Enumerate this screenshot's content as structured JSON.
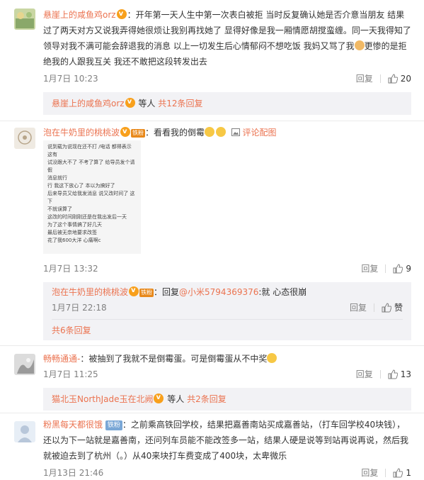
{
  "comments": [
    {
      "username": "悬崖上的咸鱼鸡orz",
      "text": "：开年第一天人生中第一次表白被拒 当时反复确认她是否介意当朋友 结果过了两天对方又说我弄得她很烦让我别再找她了 显得好像是我一厢情愿胡搅蛮缠。同一天我得知了领导对我不满可能会辞退我的消息 以上一切发生后心情郁闷不想吃饭 我妈又骂了我",
      "text_after": "更惨的是拒绝我的人跟我互关 我还不敢把这段转发出去",
      "time": "1月7日 10:23",
      "reply_label": "回复",
      "likes": "20",
      "sub_summary": {
        "name": "悬崖上的咸鱼鸡orz",
        "middle": "等人",
        "more": "共12条回复"
      }
    },
    {
      "username": "泡在牛奶里的桃桃波",
      "fan_badge": "铁粉",
      "text": "：看看我的倒霉",
      "pic_link": "评论配图",
      "time": "1月7日 13:32",
      "reply_label": "回复",
      "likes": "9",
      "screenshot_lines": [
        "说到载为说现在还不打 /电话   都得表示 这有",
        "试没跟大不了 不考了算了 给导员发个请假",
        "消息就行",
        "行 我这下放心了 本以为搞好了",
        "后来导员又给我发消息 说又改时间了 这下",
        "不就误算了",
        "这改的时间刚刚还是在我出发后一天",
        "为了这个事情搞了好几天",
        "最后被无奈地要求改签",
        "花了我600大洋 心痛啊c"
      ],
      "reply": {
        "username": "泡在牛奶里的桃桃波",
        "fan_badge": "铁粉",
        "prefix": "：回复",
        "mention": "@小米5794369376",
        "text": ":就 心态很崩",
        "time": "1月7日 22:18",
        "reply_label": "回复",
        "like_label": "赞"
      },
      "sub_more": "共6条回复"
    },
    {
      "username": "畅畅通通-",
      "text": "：被抽到了我就不是倒霉蛋。可是倒霉蛋从不中奖",
      "time": "1月7日 11:25",
      "reply_label": "回复",
      "likes": "13",
      "sub_summary": {
        "name": "猫北玉NorthJade玉在北阙",
        "middle": "等人",
        "more": "共2条回复"
      }
    },
    {
      "username": "粉黑每天都很饿",
      "fan_badge": "铁粉",
      "text": "：之前乘高铁回学校，结果把嘉善南站买成嘉善站，（打车回学校40块钱），还以为下一站就是嘉善南，还问列车员能不能改签多一站，结果人硬是说等到站再说再说，然后我就被迫去到了杭州（。）从40来块打车费变成了400块，太卑微乐",
      "time": "1月13日 21:46",
      "reply_label": "回复",
      "likes": "1"
    }
  ],
  "colors": {
    "username": "#eb7350",
    "text": "#333333",
    "meta": "#808080",
    "subbox": "#f2f2f5"
  }
}
